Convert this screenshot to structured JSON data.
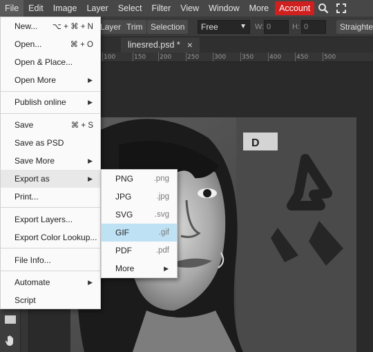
{
  "menubar": {
    "items": [
      "File",
      "Edit",
      "Image",
      "Layer",
      "Select",
      "Filter",
      "View",
      "Window",
      "More"
    ],
    "account_label": "Account",
    "icons": [
      "search-icon",
      "fullscreen-icon"
    ]
  },
  "optionsbar": {
    "layer_label": "Layer",
    "trim_label": "Trim",
    "selection_label": "Selection",
    "mode_value": "Free",
    "w_label": "W:",
    "w_value": "0",
    "h_label": "H:",
    "h_value": "0",
    "straighten_label": "Straighten"
  },
  "tab": {
    "title": "linesred.psd *",
    "close": "×"
  },
  "ruler": {
    "ticks": [
      "100",
      "150",
      "200",
      "250",
      "300",
      "350",
      "400",
      "450",
      "500"
    ]
  },
  "file_menu": {
    "items": [
      {
        "label": "New...",
        "shortcut": "⌥ + ⌘ + N"
      },
      {
        "label": "Open...",
        "shortcut": "⌘ + O"
      },
      {
        "label": "Open & Place..."
      },
      {
        "label": "Open More",
        "submenu": "▶"
      },
      {
        "label": "Publish online",
        "submenu": "▶"
      },
      {
        "label": "Save",
        "shortcut": "⌘ + S"
      },
      {
        "label": "Save as PSD"
      },
      {
        "label": "Save More",
        "submenu": "▶"
      },
      {
        "label": "Export as",
        "submenu": "▶"
      },
      {
        "label": "Print..."
      },
      {
        "label": "Export Layers..."
      },
      {
        "label": "Export Color Lookup..."
      },
      {
        "label": "File Info..."
      },
      {
        "label": "Automate",
        "submenu": "▶"
      },
      {
        "label": "Script"
      }
    ]
  },
  "export_submenu": {
    "items": [
      {
        "label": "PNG",
        "ext": ".png"
      },
      {
        "label": "JPG",
        "ext": ".jpg"
      },
      {
        "label": "SVG",
        "ext": ".svg"
      },
      {
        "label": "GIF",
        "ext": ".gif"
      },
      {
        "label": "PDF",
        "ext": ".pdf"
      },
      {
        "label": "More",
        "submenu": "▶"
      }
    ],
    "selected": "GIF"
  },
  "colors": {
    "accent_account": "#cf1f1f",
    "selected_item": "#bfe1f4"
  }
}
